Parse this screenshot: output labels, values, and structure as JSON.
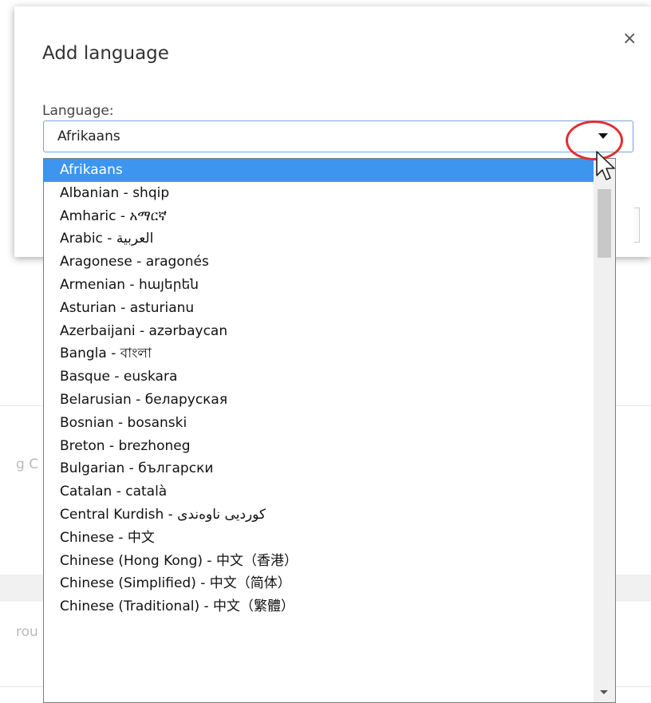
{
  "dialog": {
    "title": "Add language",
    "close_label": "×",
    "field_label": "Language:",
    "selected_value": "Afrikaans"
  },
  "background": {
    "fragment_1": "g C",
    "fragment_2": "rou"
  },
  "dropdown": {
    "options": [
      "Afrikaans",
      "Albanian - shqip",
      "Amharic - አማርኛ",
      "Arabic - العربية",
      "Aragonese - aragonés",
      "Armenian - հայերեն",
      "Asturian - asturianu",
      "Azerbaijani - azərbaycan",
      "Bangla - বাংলা",
      "Basque - euskara",
      "Belarusian - беларуская",
      "Bosnian - bosanski",
      "Breton - brezhoneg",
      "Bulgarian - български",
      "Catalan - català",
      "Central Kurdish - کوردیی ناوەندی",
      "Chinese - 中文",
      "Chinese (Hong Kong) - 中文（香港）",
      "Chinese (Simplified) - 中文（简体）",
      "Chinese (Traditional) - 中文（繁體）"
    ],
    "selected_index": 0
  },
  "colors": {
    "highlight": "#3d95f0",
    "annotation_circle": "#e03030",
    "select_border": "#7aa3d9"
  },
  "icons": {
    "close": "close-icon",
    "dropdown_arrow": "chevron-down-icon",
    "pointer": "mouse-cursor-icon"
  }
}
